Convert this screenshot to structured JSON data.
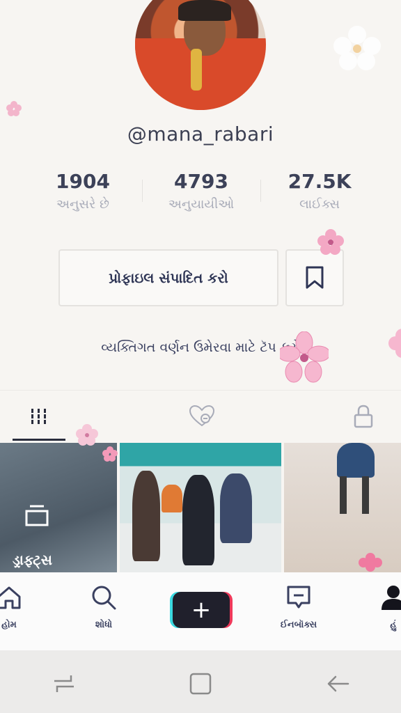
{
  "profile": {
    "username": "@mana_rabari"
  },
  "stats": [
    {
      "value": "1904",
      "label": "અનુસરે છે"
    },
    {
      "value": "4793",
      "label": "અનુયાયીઓ"
    },
    {
      "value": "27.5K",
      "label": "લાઈક્સ"
    }
  ],
  "actions": {
    "edit_profile": "પ્રોફાઇલ સંપાદિત કરો"
  },
  "bio": {
    "prompt": "વ્યક્તિગત વર્ણન ઉમેરવા માટે ટૅપ કરો"
  },
  "grid": {
    "drafts_label": "ડ્રાફ્ટ્સ"
  },
  "bottom_nav": {
    "home": "હોમ",
    "search": "શોધો",
    "inbox": "ઈનબૉક્સ",
    "me": "હું"
  },
  "colors": {
    "accent_cyan": "#3ad9e0",
    "accent_red": "#f0395a",
    "text_dark": "#3c4158"
  }
}
